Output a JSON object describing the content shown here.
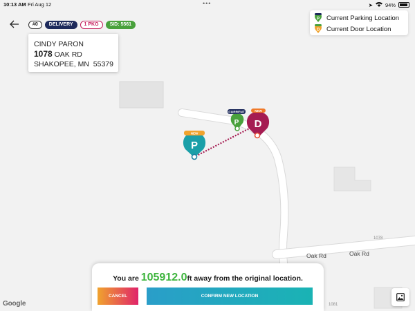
{
  "status_bar": {
    "time": "10:13 AM",
    "date": "Fri Aug 12",
    "battery": "94%",
    "battery_level": 0.94
  },
  "badges": {
    "number": "#0",
    "type": "DELIVERY",
    "packages": "1 PKG",
    "sid": "SID: 5561"
  },
  "address": {
    "name": "CINDY PARON",
    "house_number": "1078",
    "street": "OAK RD",
    "city_line": "SHAKOPEE, MN  55379"
  },
  "legend": {
    "parking_label": "Current Parking Location",
    "door_label": "Current Door Location"
  },
  "map": {
    "road_label_1": "Oak Rd",
    "road_label_2": "Oak Rd",
    "house_number_1078": "1078",
    "house_number_1081": "1081",
    "pin_current_tag": "CURRENT",
    "pin_new_tag_door": "NEW",
    "pin_new_tag_parking": "NEW",
    "pin_p_letter": "P",
    "pin_d_letter": "D",
    "legend_p": "P",
    "legend_d": "D",
    "attribution": "Google"
  },
  "panel": {
    "distance_prefix": "You are ",
    "distance_value": "105912.0",
    "distance_suffix": "ft away from the original location.",
    "cancel_label": "CANCEL",
    "confirm_label": "CONFIRM NEW LOCATION"
  },
  "colors": {
    "green": "#3db43d",
    "navy": "#1d2a5b",
    "magenta": "#a51c52",
    "teal": "#1a9fa8",
    "orange": "#f0a32e"
  }
}
